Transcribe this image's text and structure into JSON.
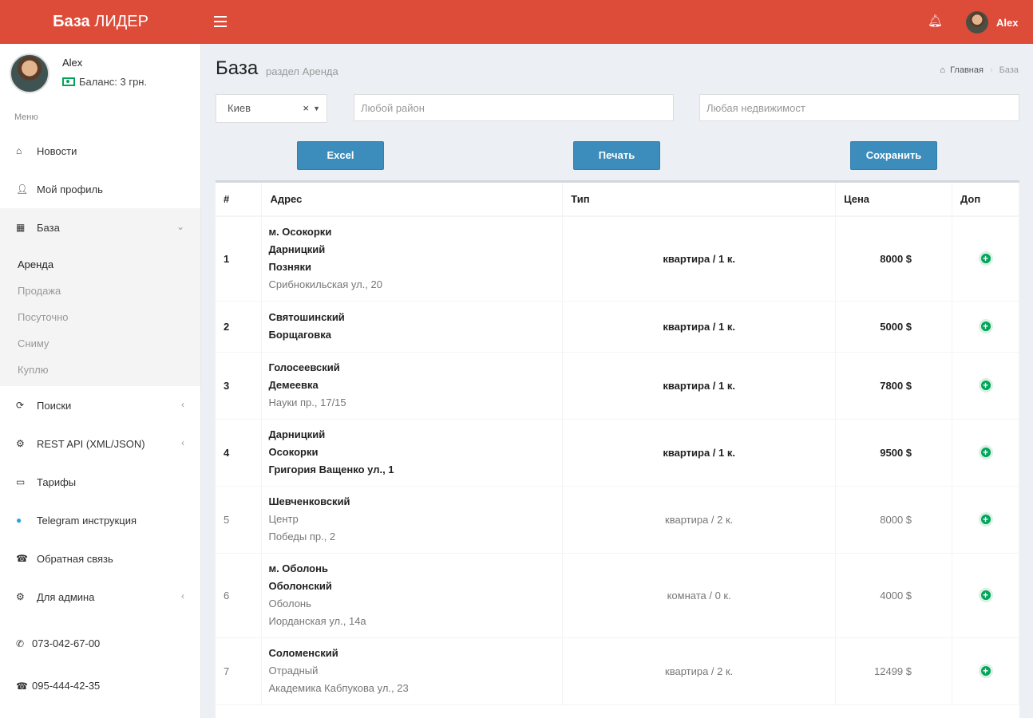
{
  "header": {
    "logo_bold": "База",
    "logo_light": "ЛИДЕР",
    "user_name": "Alex",
    "icons": {
      "menu": "hamburger-icon",
      "bell": "bell-icon"
    },
    "color": "#dd4b39"
  },
  "sidebar": {
    "user_name": "Alex",
    "balance": "Баланс: 3 грн.",
    "menu_header": "Меню",
    "items": [
      {
        "label": "Новости",
        "icon": "home-icon"
      },
      {
        "label": "Мой профиль",
        "icon": "user-icon"
      },
      {
        "label": "База",
        "icon": "building-icon"
      },
      {
        "label": "Поиски",
        "icon": "refresh-icon"
      },
      {
        "label": "REST API (XML/JSON)",
        "icon": "gear-icon"
      },
      {
        "label": "Тарифы",
        "icon": "money-icon"
      },
      {
        "label": "Telegram инструкция",
        "icon": "telegram-icon"
      },
      {
        "label": "Обратная связь",
        "icon": "phone-icon"
      },
      {
        "label": "Для админа",
        "icon": "gear-icon"
      }
    ],
    "submenu": [
      "Аренда",
      "Продажа",
      "Посуточно",
      "Сниму",
      "Куплю"
    ],
    "phones": [
      "073-042-67-00",
      "095-444-42-35"
    ]
  },
  "content": {
    "title": "База",
    "subtitle": "раздел Аренда",
    "breadcrumb": {
      "home": "Главная",
      "current": "База"
    }
  },
  "filters": {
    "city_value": "Киев",
    "district_placeholder": "Любой район",
    "type_placeholder": "Любая недвижимост"
  },
  "buttons": {
    "excel": "Excel",
    "print": "Печать",
    "save": "Сохранить",
    "color": "#3c8dbc"
  },
  "table": {
    "columns": [
      "#",
      "Адрес",
      "Тип",
      "Цена",
      "Доп"
    ],
    "rows": [
      {
        "num": "1",
        "addr_bold": [
          "м. Осокорки",
          "Дарницкий",
          "Позняки"
        ],
        "addr_normal": [
          "Срибнокильская ул., 20"
        ],
        "type": "квартира / 1 к.",
        "price": "8000 $"
      },
      {
        "num": "2",
        "addr_bold": [
          "Святошинский",
          "Борщаговка"
        ],
        "addr_normal": [],
        "type": "квартира / 1 к.",
        "price": "5000 $"
      },
      {
        "num": "3",
        "addr_bold": [
          "Голосеевский",
          "Демеевка"
        ],
        "addr_normal": [
          "Науки пр., 17/15"
        ],
        "type": "квартира / 1 к.",
        "price": "7800 $"
      },
      {
        "num": "4",
        "addr_bold": [
          "Дарницкий",
          "Осокорки",
          "Григория Ващенко ул., 1"
        ],
        "addr_normal": [],
        "type": "квартира / 1 к.",
        "price": "9500 $"
      },
      {
        "num": "5",
        "addr_bold": [
          "Шевченковский"
        ],
        "addr_normal": [
          "Центр",
          "Победы пр., 2"
        ],
        "type": "квартира / 2 к.",
        "price": "8000 $"
      },
      {
        "num": "6",
        "addr_bold": [
          "м. Оболонь",
          "Оболонский"
        ],
        "addr_normal": [
          "Оболонь",
          "Иорданская ул., 14а"
        ],
        "type": "комната / 0 к.",
        "price": "4000 $"
      },
      {
        "num": "7",
        "addr_bold": [
          "Соломенский"
        ],
        "addr_normal": [
          "Отрадный",
          "Академика Кабпукова ул., 23"
        ],
        "type": "квартира / 2 к.",
        "price": "12499 $"
      }
    ]
  }
}
